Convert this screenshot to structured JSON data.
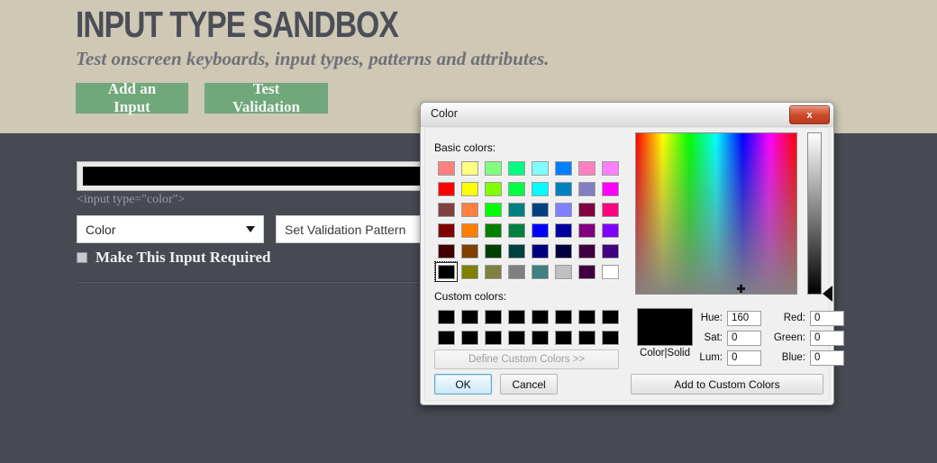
{
  "page": {
    "title": "INPUT TYPE SANDBOX",
    "subtitle": "Test onscreen keyboards, input types, patterns and attributes.",
    "header_bg": "#cfc8b5",
    "body_bg": "#474a53",
    "accent_green": "#70a87b",
    "buttons": {
      "add_input": "Add an Input",
      "test_validation": "Test Validation"
    }
  },
  "form": {
    "color_input_value": "#000000",
    "code_label": "<input type=\"color\">",
    "type_select_value": "Color",
    "pattern_input_value": "Set Validation Pattern",
    "pattern_input_placeholder": "Set Validation Pattern",
    "required_label": "Make This Input Required",
    "required_checked": false
  },
  "dialog": {
    "title": "Color",
    "close_label": "x",
    "basic_colors_label": "Basic colors:",
    "custom_colors_label": "Custom colors:",
    "define_custom_label": "Define Custom Colors >>",
    "ok_label": "OK",
    "cancel_label": "Cancel",
    "add_to_custom_label": "Add to Custom Colors",
    "color_solid_label": "Color|Solid",
    "preview_color": "#000000",
    "basic_colors": [
      "#ff8080",
      "#ffff80",
      "#80ff80",
      "#00ff80",
      "#80ffff",
      "#0080ff",
      "#ff80c0",
      "#ff80ff",
      "#ff0000",
      "#ffff00",
      "#80ff00",
      "#00ff40",
      "#00ffff",
      "#0080c0",
      "#8080c0",
      "#ff00ff",
      "#804040",
      "#ff8040",
      "#00ff00",
      "#008080",
      "#004080",
      "#8080ff",
      "#800040",
      "#ff0080",
      "#800000",
      "#ff8000",
      "#008000",
      "#008040",
      "#0000ff",
      "#0000a0",
      "#800080",
      "#8000ff",
      "#400000",
      "#804000",
      "#004000",
      "#004040",
      "#000080",
      "#000040",
      "#400040",
      "#400080",
      "#000000",
      "#808000",
      "#808040",
      "#808080",
      "#408080",
      "#c0c0c0",
      "#400040",
      "#ffffff"
    ],
    "basic_selected_index": 40,
    "custom_colors": [
      "#000000",
      "#000000",
      "#000000",
      "#000000",
      "#000000",
      "#000000",
      "#000000",
      "#000000",
      "#000000",
      "#000000",
      "#000000",
      "#000000",
      "#000000",
      "#000000",
      "#000000",
      "#000000"
    ],
    "fields": {
      "hue_label": "Hue:",
      "hue_value": "160",
      "sat_label": "Sat:",
      "sat_value": "0",
      "lum_label": "Lum:",
      "lum_value": "0",
      "red_label": "Red:",
      "red_value": "0",
      "green_label": "Green:",
      "green_value": "0",
      "blue_label": "Blue:",
      "blue_value": "0"
    }
  }
}
